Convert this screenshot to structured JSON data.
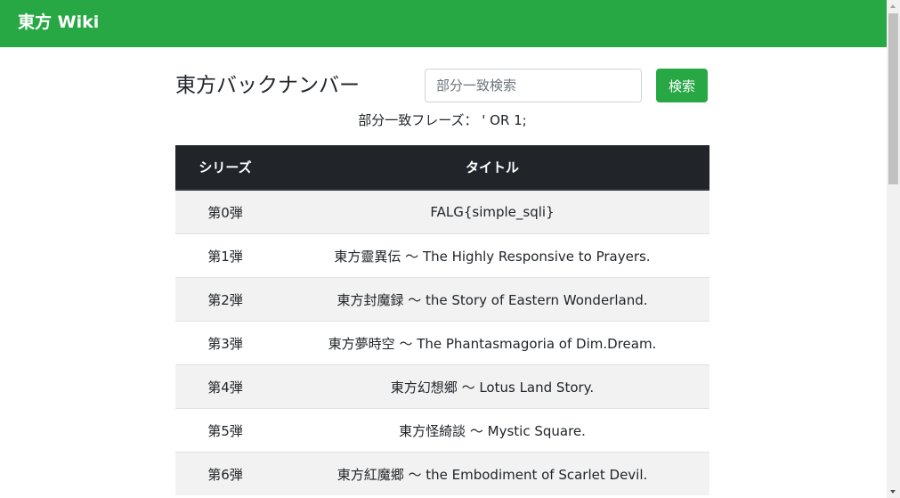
{
  "navbar": {
    "brand": "東方 Wiki",
    "color": "#28a745"
  },
  "main": {
    "title": "東方バックナンバー",
    "search": {
      "placeholder": "部分一致検索",
      "value": "",
      "button_label": "検索"
    },
    "query_line": "部分一致フレーズ： ' OR 1;"
  },
  "table": {
    "headers": [
      "シリーズ",
      "タイトル"
    ],
    "rows": [
      {
        "series": "第0弾",
        "title": "FALG{simple_sqli}"
      },
      {
        "series": "第1弾",
        "title": "東方靈異伝 〜 The Highly Responsive to Prayers."
      },
      {
        "series": "第2弾",
        "title": "東方封魔録 〜 the Story of Eastern Wonderland."
      },
      {
        "series": "第3弾",
        "title": "東方夢時空 〜 The Phantasmagoria of Dim.Dream."
      },
      {
        "series": "第4弾",
        "title": "東方幻想郷 〜 Lotus Land Story."
      },
      {
        "series": "第5弾",
        "title": "東方怪綺談 〜 Mystic Square."
      },
      {
        "series": "第6弾",
        "title": "東方紅魔郷 〜 the Embodiment of Scarlet Devil."
      }
    ]
  },
  "icons": {
    "scroll_up": "triangle-up-icon",
    "scroll_down": "triangle-down-icon"
  }
}
